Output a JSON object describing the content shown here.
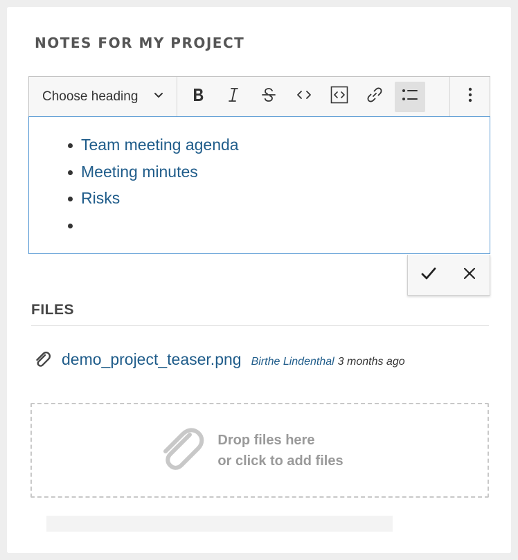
{
  "notes": {
    "title": "NOTES FOR MY PROJECT",
    "toolbar": {
      "heading_dropdown_label": "Choose heading",
      "tools": [
        "bold-icon",
        "italic-icon",
        "strikethrough-icon",
        "code-icon",
        "code-block-icon",
        "link-icon",
        "bulleted-list-icon"
      ],
      "active_tool": "bulleted-list-icon",
      "more_icon": "more-vertical-icon"
    },
    "editor": {
      "items": [
        "Team meeting agenda",
        "Meeting minutes",
        "Risks",
        ""
      ]
    },
    "actions": {
      "confirm_icon": "check-icon",
      "cancel_icon": "close-icon"
    }
  },
  "files": {
    "title": "FILES",
    "items": [
      {
        "name": "demo_project_teaser.png",
        "author": "Birthe Lindenthal",
        "time": "3 months ago"
      }
    ],
    "dropzone": {
      "line1": "Drop files here",
      "line2": "or click to add files"
    }
  },
  "colors": {
    "link": "#1f5c8a",
    "editor_focus_border": "#5b9bd5",
    "toolbar_bg": "#f7f7f7",
    "dropzone_text": "#9a9a9a"
  }
}
